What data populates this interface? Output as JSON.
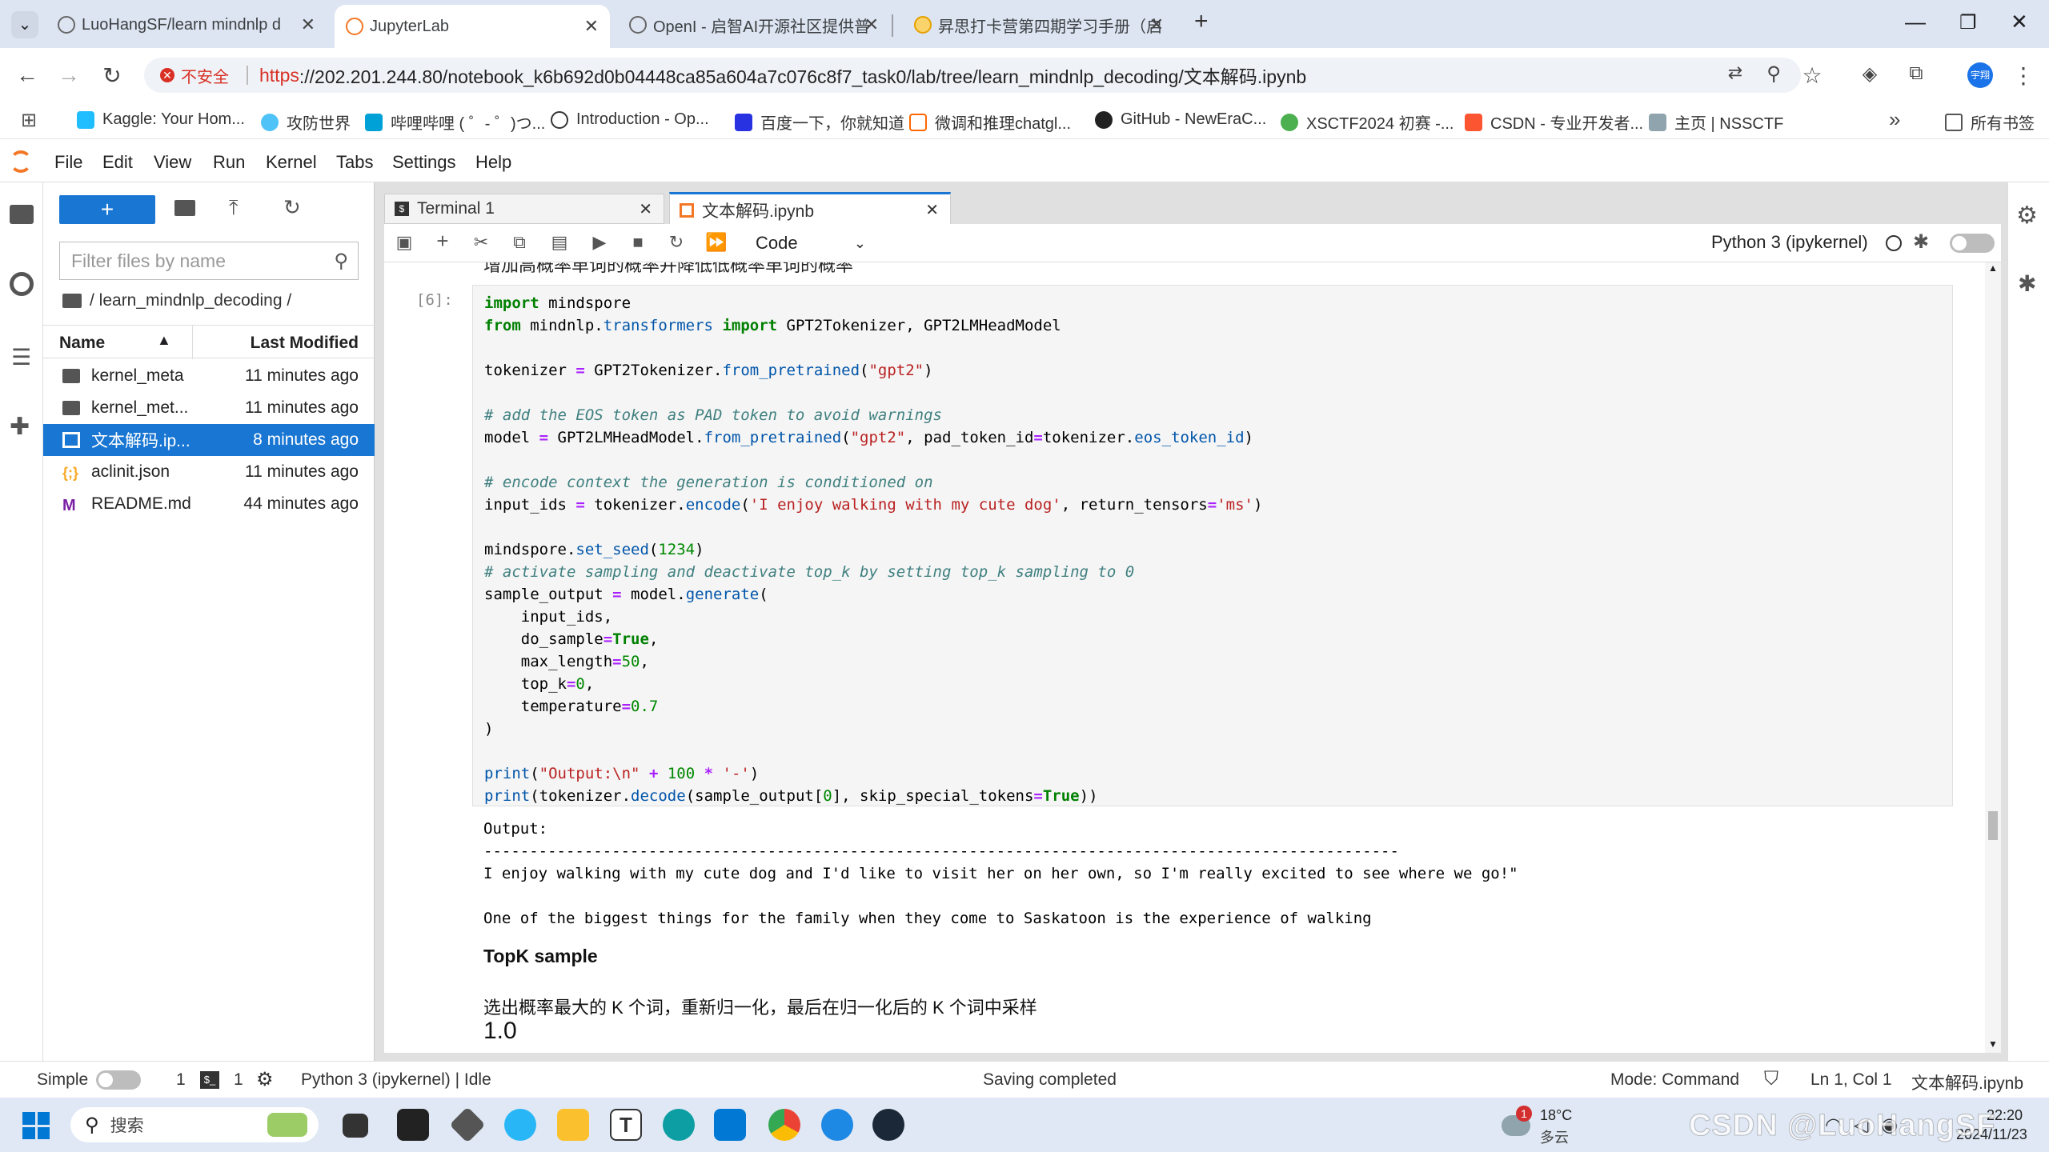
{
  "browser": {
    "tabs": [
      {
        "title": "LuoHangSF/learn mindnlp d",
        "active": false
      },
      {
        "title": "JupyterLab",
        "active": true
      },
      {
        "title": "OpenI - 启智AI开源社区提供普",
        "active": false
      },
      {
        "title": "昇思打卡营第四期学习手册（启",
        "active": false
      }
    ],
    "new_tab": "+",
    "security_label": "不安全",
    "url_scheme": "https",
    "url_rest": "://202.201.244.80/notebook_k6b692d0b04448ca85a604a7c076c8f7_task0/lab/tree/learn_mindnlp_decoding/文本解码.ipynb",
    "profile_badge": "宇翔",
    "bookmarks": [
      "Kaggle: Your Hom...",
      "攻防世界",
      "哔哩哔哩 ( ゜- ゜)つ...",
      "Introduction - Op...",
      "百度一下，你就知道",
      "微调和推理chatgl...",
      "GitHub - NewEraC...",
      "XSCTF2024 初赛 -...",
      "CSDN - 专业开发者...",
      "主页 | NSSCTF"
    ],
    "bookmarks_more": "»",
    "all_bookmarks": "所有书签"
  },
  "menu": [
    "File",
    "Edit",
    "View",
    "Run",
    "Kernel",
    "Tabs",
    "Settings",
    "Help"
  ],
  "filebrowser": {
    "new_label": "+",
    "filter_placeholder": "Filter files by name",
    "path": "/ learn_mindnlp_decoding /",
    "col_name": "Name",
    "col_modified": "Last Modified",
    "files": [
      {
        "name": "kernel_meta",
        "modified": "11 minutes ago",
        "type": "folder"
      },
      {
        "name": "kernel_met...",
        "modified": "11 minutes ago",
        "type": "folder"
      },
      {
        "name": "文本解码.ip...",
        "modified": "8 minutes ago",
        "type": "notebook",
        "selected": true
      },
      {
        "name": "aclinit.json",
        "modified": "11 minutes ago",
        "type": "json"
      },
      {
        "name": "README.md",
        "modified": "44 minutes ago",
        "type": "markdown"
      }
    ]
  },
  "notebook": {
    "tabs": [
      {
        "label": "Terminal 1",
        "active": false
      },
      {
        "label": "文本解码.ipynb",
        "active": true
      }
    ],
    "cell_type": "Code",
    "kernel_name": "Python 3 (ipykernel)",
    "top_partial_text": "增加高概率单词的概率并降低低概率单词的概率",
    "prompt": "[6]:",
    "output_lines": [
      "Output:",
      "----------------------------------------------------------------------------------------------------",
      "I enjoy walking with my cute dog and I'd like to visit her on her own, so I'm really excited to see where we go!\"",
      "",
      "One of the biggest things for the family when they come to Saskatoon is the experience of walking"
    ],
    "md_heading": "TopK sample",
    "md_text": "选出概率最大的 K 个词，重新归一化，最后在归一化后的 K 个词中采样",
    "partial_value": "1.0"
  },
  "status": {
    "mode_simple": "Simple",
    "count1": "1",
    "count2": "1",
    "kernel_status": "Python 3 (ipykernel) | Idle",
    "saving": "Saving completed",
    "mode": "Mode: Command",
    "position": "Ln 1, Col 1",
    "filename": "文本解码.ipynb"
  },
  "taskbar": {
    "search_placeholder": "搜索",
    "weather_temp": "18°C",
    "weather_desc": "多云",
    "notification_count": "1",
    "time": "22:20",
    "date": "2024/11/23",
    "watermark": "CSDN @LuoHangSF"
  },
  "colors": {
    "accent": "#1976d2",
    "chrome_tab": "#dee5f2",
    "taskbar": "#dfe8f4"
  }
}
